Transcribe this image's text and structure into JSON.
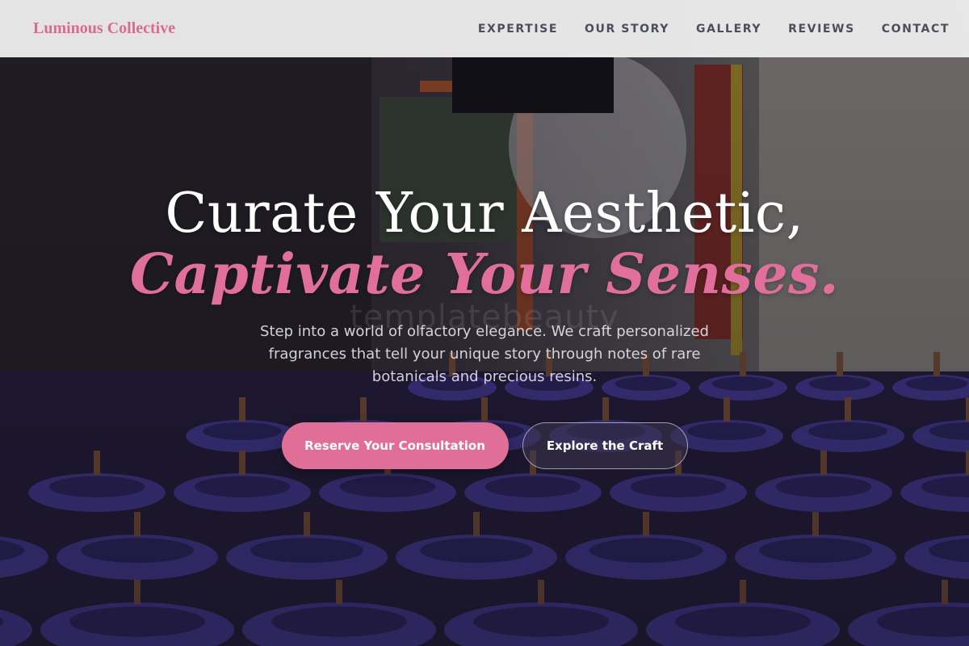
{
  "header": {
    "brand": "Luminous Collective",
    "nav": [
      {
        "label": "EXPERTISE"
      },
      {
        "label": "OUR STORY"
      },
      {
        "label": "GALLERY"
      },
      {
        "label": "REVIEWS"
      },
      {
        "label": "CONTACT"
      }
    ]
  },
  "hero": {
    "headline_line1": "Curate Your Aesthetic,",
    "headline_line2": "Captivate Your Senses.",
    "subtext": "Step into a world of olfactory elegance. We craft personalized fragrances that tell your unique story through notes of rare botanicals and precious resins.",
    "watermark": "templatebeauty",
    "primary_cta": "Reserve Your Consultation",
    "secondary_cta": "Explore the Craft",
    "background_image": "candle-workshop-photo"
  },
  "colors": {
    "accent": "#df6f97",
    "brand": "#d86b92",
    "nav_text": "#4a4f5b",
    "header_bg": "#ececec"
  }
}
